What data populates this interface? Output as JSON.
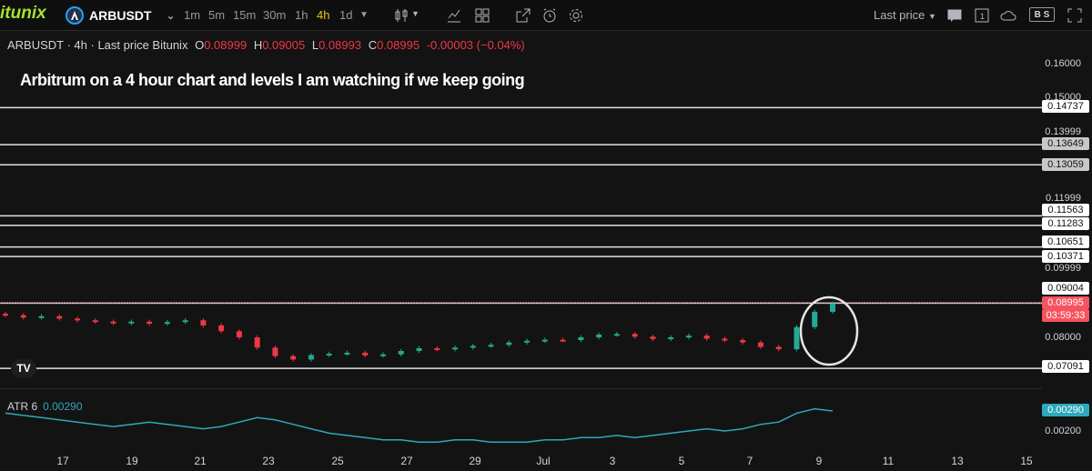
{
  "toolbar": {
    "brand": "itunix",
    "symbol": "ARBUSDT",
    "timeframes": [
      "1m",
      "5m",
      "15m",
      "30m",
      "1h",
      "4h",
      "1d"
    ],
    "active_timeframe": "4h",
    "price_type": "Last price",
    "bs_label": "B S"
  },
  "legend": {
    "title": "ARBUSDT · 4h · Last price Bitunix",
    "o_label": "O",
    "o": "0.08999",
    "h_label": "H",
    "h": "0.09005",
    "l_label": "L",
    "l": "0.08993",
    "c_label": "C",
    "c": "0.08995",
    "change": "-0.00003 (−0.04%)"
  },
  "annotation": "Arbitrum on a 4 hour chart and levels I am watching if we keep going",
  "price_axis": [
    "0.16000",
    "0.15000",
    "0.13999",
    "0.11999",
    "0.09999",
    "0.08000"
  ],
  "level_tags": [
    "0.14737",
    "0.13649",
    "0.13059",
    "0.11563",
    "0.11283",
    "0.10651",
    "0.10371",
    "0.09004",
    "0.07091"
  ],
  "current_price": {
    "value": "0.08995",
    "countdown": "03:59:33"
  },
  "atr": {
    "name": "ATR 6",
    "value": "0.00290",
    "axis": "0.00200"
  },
  "x_axis": [
    "17",
    "19",
    "21",
    "23",
    "25",
    "27",
    "29",
    "Jul",
    "3",
    "5",
    "7",
    "9",
    "11",
    "13",
    "15"
  ],
  "colors": {
    "up": "#22ab94",
    "down": "#f23645",
    "atr": "#2ea8bc",
    "accent": "#f0c419"
  },
  "chart_data": {
    "type": "candlestick",
    "levels": [
      0.14737,
      0.13649,
      0.13059,
      0.11563,
      0.11283,
      0.10651,
      0.10371,
      0.09004,
      0.07091
    ],
    "approx_close_path": [
      0.0865,
      0.0858,
      0.0862,
      0.0855,
      0.085,
      0.0846,
      0.0842,
      0.0846,
      0.084,
      0.0845,
      0.085,
      0.0835,
      0.0818,
      0.08,
      0.077,
      0.0745,
      0.0735,
      0.0748,
      0.0752,
      0.0755,
      0.0747,
      0.075,
      0.076,
      0.0768,
      0.0765,
      0.077,
      0.0775,
      0.0778,
      0.0785,
      0.079,
      0.0793,
      0.0792,
      0.08,
      0.0808,
      0.081,
      0.0802,
      0.0795,
      0.08,
      0.0805,
      0.0796,
      0.0792,
      0.0785,
      0.0772,
      0.0765,
      0.083,
      0.0875,
      0.08995
    ],
    "atr_values": [
      0.0028,
      0.0027,
      0.0026,
      0.0025,
      0.0024,
      0.0023,
      0.0022,
      0.0023,
      0.0024,
      0.0023,
      0.0022,
      0.0021,
      0.0022,
      0.0024,
      0.0026,
      0.0025,
      0.0023,
      0.0021,
      0.0019,
      0.0018,
      0.0017,
      0.0016,
      0.0016,
      0.0015,
      0.0015,
      0.0016,
      0.0016,
      0.0015,
      0.0015,
      0.0015,
      0.0016,
      0.0016,
      0.0017,
      0.0017,
      0.0018,
      0.0017,
      0.0018,
      0.0019,
      0.002,
      0.0021,
      0.002,
      0.0021,
      0.0023,
      0.0024,
      0.0028,
      0.003,
      0.0029
    ],
    "ylim": [
      0.0689,
      0.164
    ]
  }
}
